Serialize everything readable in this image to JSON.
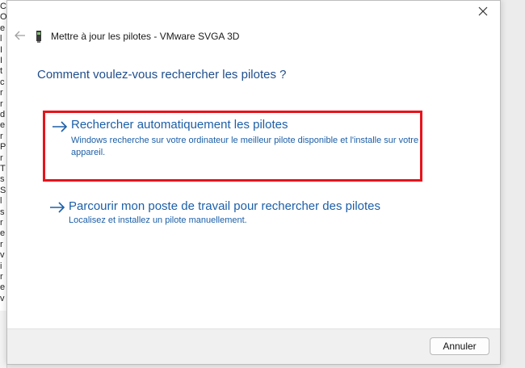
{
  "background": {
    "left_window_chars": [
      "C",
      "O",
      "e",
      "l",
      "I",
      "I",
      "t",
      "c",
      "r",
      "r",
      "d",
      "e",
      "r",
      "P",
      "r",
      "T",
      "s",
      "S",
      "l",
      "s",
      "r",
      "e",
      "r",
      "v",
      "i",
      "r",
      "e",
      "v"
    ]
  },
  "dialog": {
    "title": "Mettre à jour les pilotes - VMware SVGA 3D",
    "heading": "Comment voulez-vous rechercher les pilotes ?",
    "options": [
      {
        "title": "Rechercher automatiquement les pilotes",
        "description": "Windows recherche sur votre ordinateur le meilleur pilote disponible et l'installe sur votre appareil."
      },
      {
        "title": "Parcourir mon poste de travail pour rechercher des pilotes",
        "description": "Localisez et installez un pilote manuellement."
      }
    ],
    "cancel_label": "Annuler"
  },
  "colors": {
    "accent": "#1c5fa8",
    "heading": "#1f4e8c",
    "highlight_border": "#e8131b"
  },
  "icons": {
    "close": "close-icon",
    "back": "back-arrow-icon",
    "device": "display-adapter-icon",
    "option_arrow": "arrow-right-icon"
  }
}
